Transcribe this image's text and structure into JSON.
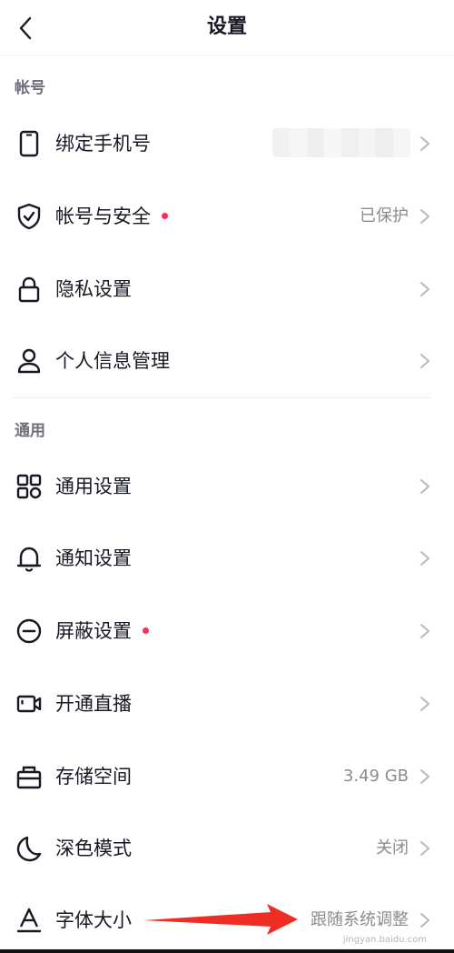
{
  "header": {
    "title": "设置"
  },
  "sections": [
    {
      "title": "帐号",
      "items": [
        {
          "label": "绑定手机号",
          "value": "",
          "dot": false,
          "icon": "phone-icon"
        },
        {
          "label": "帐号与安全",
          "value": "已保护",
          "dot": true,
          "icon": "shield-check-icon"
        },
        {
          "label": "隐私设置",
          "value": "",
          "dot": false,
          "icon": "lock-icon"
        },
        {
          "label": "个人信息管理",
          "value": "",
          "dot": false,
          "icon": "person-icon"
        }
      ]
    },
    {
      "title": "通用",
      "items": [
        {
          "label": "通用设置",
          "value": "",
          "dot": false,
          "icon": "grid-icon"
        },
        {
          "label": "通知设置",
          "value": "",
          "dot": false,
          "icon": "bell-icon"
        },
        {
          "label": "屏蔽设置",
          "value": "",
          "dot": true,
          "icon": "block-icon"
        },
        {
          "label": "开通直播",
          "value": "",
          "dot": false,
          "icon": "video-camera-icon"
        },
        {
          "label": "存储空间",
          "value": "3.49 GB",
          "dot": false,
          "icon": "storage-box-icon"
        },
        {
          "label": "深色模式",
          "value": "关闭",
          "dot": false,
          "icon": "moon-icon"
        },
        {
          "label": "字体大小",
          "value": "跟随系统调整",
          "dot": false,
          "icon": "font-size-icon"
        }
      ]
    }
  ],
  "watermark": "jingyan.baidu.com",
  "colors": {
    "accent": "#fe2c55",
    "arrow": "#ee2d24",
    "text": "#161823",
    "secondary_text": "#8a8b91"
  }
}
